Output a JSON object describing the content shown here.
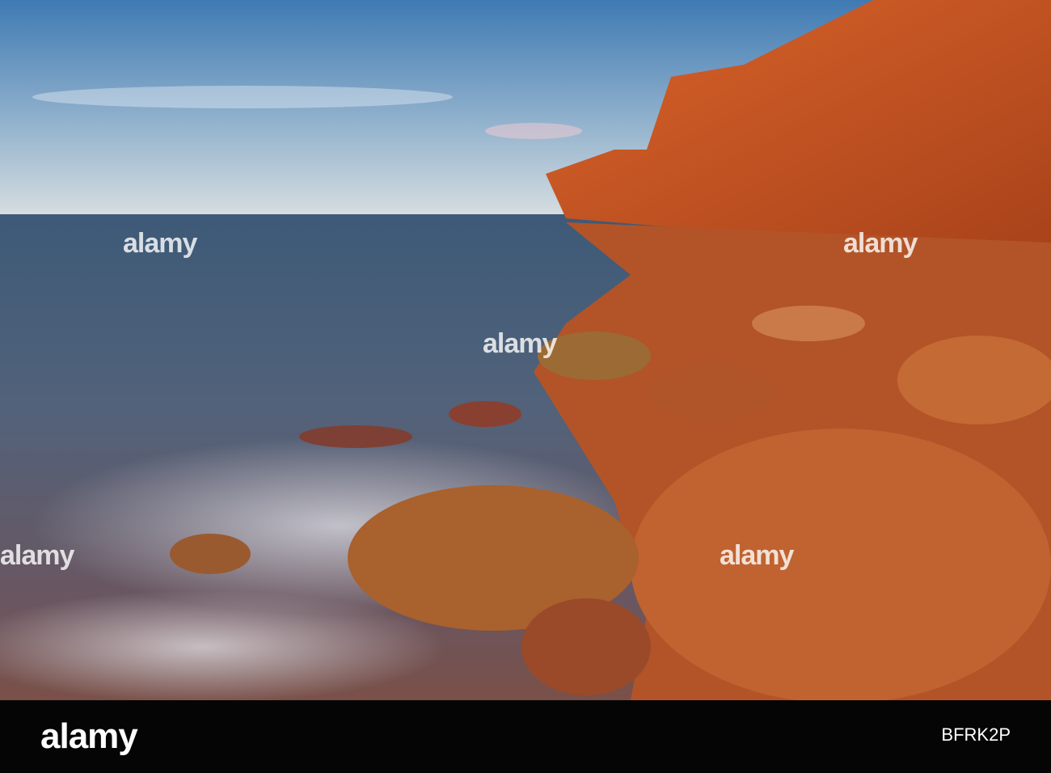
{
  "watermark": {
    "brand": "alamy"
  },
  "footer": {
    "logo": "alamy",
    "image_id": "BFRK2P"
  },
  "colors": {
    "sky_top": "#3f7ab3",
    "sky_horizon": "#cfd9e0",
    "sea": "#4a5a6e",
    "cliff": "#c8551f",
    "rock": "#b85a2a",
    "bar": "#050505"
  }
}
